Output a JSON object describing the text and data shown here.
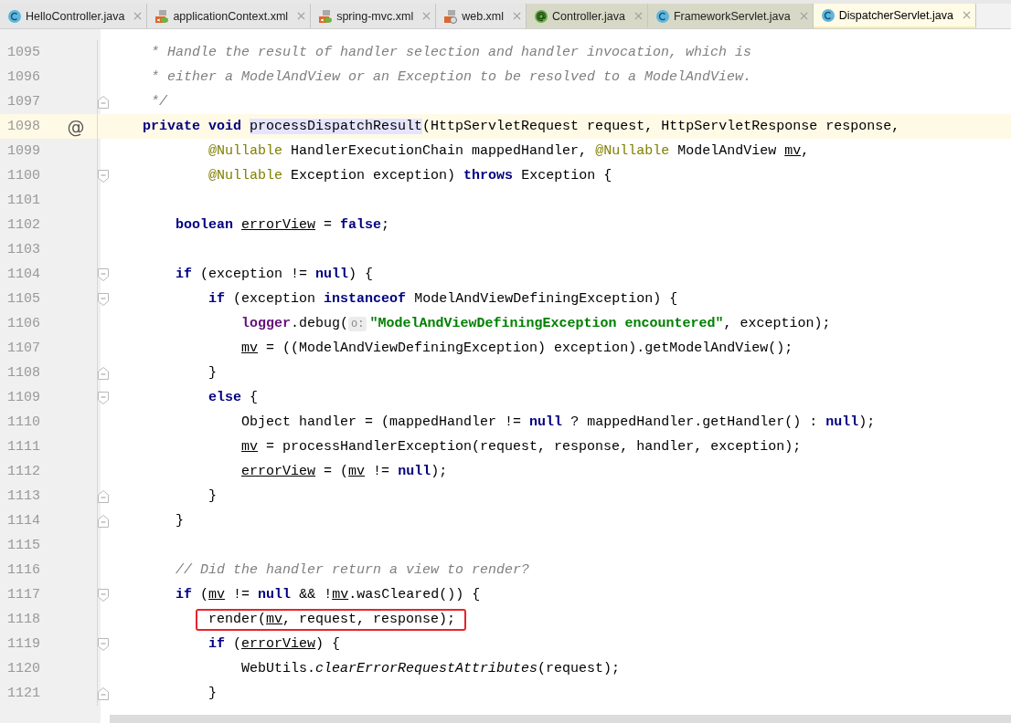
{
  "tabs": [
    {
      "label": "HelloController.java",
      "kind": "class",
      "color": "#e6e6e6",
      "selected": false
    },
    {
      "label": "applicationContext.xml",
      "kind": "xml",
      "color": "#e6e6e6",
      "selected": false
    },
    {
      "label": "spring-mvc.xml",
      "kind": "xml",
      "color": "#e6e6e6",
      "selected": false
    },
    {
      "label": "web.xml",
      "kind": "web",
      "color": "#e6e6e6",
      "selected": false
    },
    {
      "label": "Controller.java",
      "kind": "annotation",
      "color": "#d8d8c6",
      "selected": false
    },
    {
      "label": "FrameworkServlet.java",
      "kind": "class",
      "color": "#d8d8c6",
      "selected": false
    },
    {
      "label": "DispatcherServlet.java",
      "kind": "class",
      "color": "#fffbe6",
      "selected": true
    }
  ],
  "editor": {
    "lines": [
      {
        "number": "1095",
        "kind": "plain",
        "segments": [
          {
            "kind": "comment",
            "text": "     * Handle the result of handler selection and handler invocation, which is"
          }
        ]
      },
      {
        "number": "1096",
        "kind": "plain",
        "segments": [
          {
            "kind": "comment",
            "text": "     * either a ModelAndView or an Exception to be resolved to a ModelAndView."
          }
        ]
      },
      {
        "number": "1097",
        "kind": "block-end",
        "segments": [
          {
            "kind": "comment",
            "text": "     */"
          }
        ]
      },
      {
        "number": "1098",
        "kind": "plain",
        "current": true,
        "gutter_mark": "@",
        "segments": [
          {
            "kind": "keyword",
            "text": "    private"
          },
          {
            "kind": "keyword",
            "text": " void "
          },
          {
            "kind": "declaration",
            "text": "processDispatchResult"
          },
          {
            "kind": "plain",
            "text": "(HttpServletRequest request, HttpServletResponse response,"
          }
        ]
      },
      {
        "number": "1099",
        "kind": "plain",
        "segments": [
          {
            "kind": "annotation",
            "text": "            @Nullable"
          },
          {
            "kind": "plain",
            "text": " HandlerExecutionChain mappedHandler, "
          },
          {
            "kind": "annotation",
            "text": "@Nullable"
          },
          {
            "kind": "plain",
            "text": " ModelAndView "
          },
          {
            "kind": "variable",
            "text": "mv"
          },
          {
            "kind": "plain",
            "text": ","
          }
        ]
      },
      {
        "number": "1100",
        "kind": "block-start",
        "segments": [
          {
            "kind": "annotation",
            "text": "            @Nullable"
          },
          {
            "kind": "plain",
            "text": " Exception exception) "
          },
          {
            "kind": "keyword",
            "text": "throws"
          },
          {
            "kind": "plain",
            "text": " Exception {"
          }
        ]
      },
      {
        "number": "1101",
        "kind": "plain"
      },
      {
        "number": "1102",
        "kind": "plain",
        "segments": [
          {
            "kind": "keyword",
            "text": "        boolean "
          },
          {
            "kind": "variable",
            "text": "errorView"
          },
          {
            "kind": "plain",
            "text": " = "
          },
          {
            "kind": "keyword",
            "text": "false"
          },
          {
            "kind": "plain",
            "text": ";"
          }
        ]
      },
      {
        "number": "1103",
        "kind": "plain"
      },
      {
        "number": "1104",
        "kind": "block-start",
        "segments": [
          {
            "kind": "keyword",
            "text": "        if"
          },
          {
            "kind": "plain",
            "text": " (exception != "
          },
          {
            "kind": "keyword",
            "text": "null"
          },
          {
            "kind": "plain",
            "text": ") {"
          }
        ]
      },
      {
        "number": "1105",
        "kind": "block-start",
        "segments": [
          {
            "kind": "keyword",
            "text": "            if"
          },
          {
            "kind": "plain",
            "text": " (exception "
          },
          {
            "kind": "keyword",
            "text": "instanceof"
          },
          {
            "kind": "plain",
            "text": " ModelAndViewDefiningException) {"
          }
        ]
      },
      {
        "number": "1106",
        "kind": "plain",
        "segments": [
          {
            "kind": "field",
            "text": "                logger"
          },
          {
            "kind": "plain",
            "text": ".debug("
          },
          {
            "kind": "hint",
            "text": "o:"
          },
          {
            "kind": "string",
            "text": "\"ModelAndViewDefiningException encountered\""
          },
          {
            "kind": "plain",
            "text": ", exception);"
          }
        ]
      },
      {
        "number": "1107",
        "kind": "plain",
        "segments": [
          {
            "kind": "variable",
            "text": "                mv"
          },
          {
            "kind": "plain",
            "text": " = ((ModelAndViewDefiningException) exception).getModelAndView();"
          }
        ]
      },
      {
        "number": "1108",
        "kind": "block-end",
        "segments": [
          {
            "kind": "plain",
            "text": "            }"
          }
        ]
      },
      {
        "number": "1109",
        "kind": "block-start",
        "segments": [
          {
            "kind": "keyword",
            "text": "            else"
          },
          {
            "kind": "plain",
            "text": " {"
          }
        ]
      },
      {
        "number": "1110",
        "kind": "plain",
        "segments": [
          {
            "kind": "plain",
            "text": "                Object handler = (mappedHandler != "
          },
          {
            "kind": "keyword",
            "text": "null"
          },
          {
            "kind": "plain",
            "text": " ? mappedHandler.getHandler() : "
          },
          {
            "kind": "keyword",
            "text": "null"
          },
          {
            "kind": "plain",
            "text": ");"
          }
        ]
      },
      {
        "number": "1111",
        "kind": "plain",
        "segments": [
          {
            "kind": "variable",
            "text": "                mv"
          },
          {
            "kind": "plain",
            "text": " = processHandlerException(request, response, handler, exception);"
          }
        ]
      },
      {
        "number": "1112",
        "kind": "plain",
        "segments": [
          {
            "kind": "variable",
            "text": "                errorView"
          },
          {
            "kind": "plain",
            "text": " = ("
          },
          {
            "kind": "variable",
            "text": "mv"
          },
          {
            "kind": "plain",
            "text": " != "
          },
          {
            "kind": "keyword",
            "text": "null"
          },
          {
            "kind": "plain",
            "text": ");"
          }
        ]
      },
      {
        "number": "1113",
        "kind": "block-end",
        "segments": [
          {
            "kind": "plain",
            "text": "            }"
          }
        ]
      },
      {
        "number": "1114",
        "kind": "block-end",
        "segments": [
          {
            "kind": "plain",
            "text": "        }"
          }
        ]
      },
      {
        "number": "1115",
        "kind": "plain"
      },
      {
        "number": "1116",
        "kind": "plain",
        "segments": [
          {
            "kind": "comment",
            "text": "        // Did the handler return a view to render?"
          }
        ]
      },
      {
        "number": "1117",
        "kind": "block-start",
        "segments": [
          {
            "kind": "keyword",
            "text": "        if"
          },
          {
            "kind": "plain",
            "text": " ("
          },
          {
            "kind": "variable",
            "text": "mv"
          },
          {
            "kind": "plain",
            "text": " != "
          },
          {
            "kind": "keyword",
            "text": "null"
          },
          {
            "kind": "plain",
            "text": " && !"
          },
          {
            "kind": "variable",
            "text": "mv"
          },
          {
            "kind": "plain",
            "text": ".wasCleared()) {"
          }
        ]
      },
      {
        "number": "1118",
        "kind": "plain",
        "boxed": true,
        "segments": [
          {
            "kind": "plain",
            "text": "            render("
          },
          {
            "kind": "variable",
            "text": "mv"
          },
          {
            "kind": "plain",
            "text": ", request, response);"
          }
        ]
      },
      {
        "number": "1119",
        "kind": "block-start",
        "segments": [
          {
            "kind": "keyword",
            "text": "            if"
          },
          {
            "kind": "plain",
            "text": " ("
          },
          {
            "kind": "variable",
            "text": "errorView"
          },
          {
            "kind": "plain",
            "text": ") {"
          }
        ]
      },
      {
        "number": "1120",
        "kind": "plain",
        "segments": [
          {
            "kind": "plain",
            "text": "                WebUtils."
          },
          {
            "kind": "italic",
            "text": "clearErrorRequestAttributes"
          },
          {
            "kind": "plain",
            "text": "(request);"
          }
        ]
      },
      {
        "number": "1121",
        "kind": "block-end",
        "segments": [
          {
            "kind": "plain",
            "text": "            }"
          }
        ]
      }
    ]
  }
}
